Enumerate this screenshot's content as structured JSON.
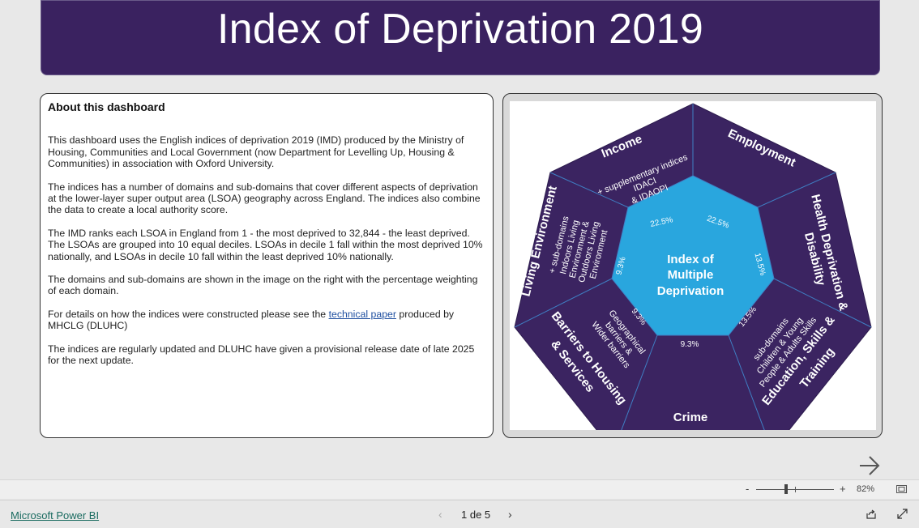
{
  "header": {
    "title": "Index of Deprivation 2019"
  },
  "about": {
    "heading": "About this dashboard",
    "p1": "This dashboard uses the English indices of deprivation 2019 (IMD) produced by the Ministry of Housing, Communities and Local Government (now Department for Levelling Up, Housing & Communities) in association with Oxford University.",
    "p2": "The indices has a number of domains and sub-domains that cover different aspects of deprivation at the lower-layer super output area (LSOA) geography across England.  The indices also combine the data to create a local authority score.",
    "p3": "The IMD ranks each LSOA in England from 1 - the most deprived to 32,844 - the least deprived.  The LSOAs are grouped into 10 equal deciles. LSOAs in decile 1 fall within the most deprived 10% nationally, and LSOAs in decile 10 fall within the least deprived 10% nationally.",
    "p4": "The domains and sub-domains are shown in the image on the right with the percentage weighting of each domain.",
    "p5_before": "For details on how the indices were constructed please see the ",
    "p5_link": "technical paper",
    "p5_after": " produced by MHCLG (DLUHC)",
    "p6": "The indices are regularly updated and DLUHC have given a provisional release date of late 2025 for the next update."
  },
  "diagram": {
    "center_lines": [
      "Index of",
      "Multiple",
      "Deprivation"
    ],
    "domains": {
      "income": "Income",
      "employment": "Employment",
      "health_line1": "Health Deprivation &",
      "health_line2": "Disability",
      "education_line1": "Education, Skills &",
      "education_line2": "Training",
      "crime": "Crime",
      "barriers_line1": "Barriers to Housing",
      "barriers_line2": "& Services",
      "living": "Living Environment"
    },
    "subs": {
      "income": [
        "+ supplementary indices",
        "IDACI",
        "& IDAOPI"
      ],
      "education": [
        "sub-domains",
        "Children & Young",
        "People & Adults Skills"
      ],
      "barriers": [
        "Geographical",
        "barriers &",
        "Wider barriers"
      ],
      "living": [
        "+ sub-domains",
        "Indoors Living",
        "Environment &",
        "Outdoors Living",
        "Environment"
      ]
    },
    "weights": {
      "income": "22.5%",
      "employment": "22.5%",
      "health": "13.5%",
      "education": "13.5%",
      "crime": "9.3%",
      "barriers": "9.3%",
      "living": "9.3%"
    },
    "colors": {
      "outer": "#3b2461",
      "inner": "#29a6de",
      "line": "#3f7fc4"
    }
  },
  "zoom": {
    "minus": "-",
    "plus": "+",
    "level": "82%"
  },
  "footer": {
    "brand": "Microsoft Power BI",
    "page_indicator": "1 de 5",
    "prev": "‹",
    "next": "›"
  }
}
